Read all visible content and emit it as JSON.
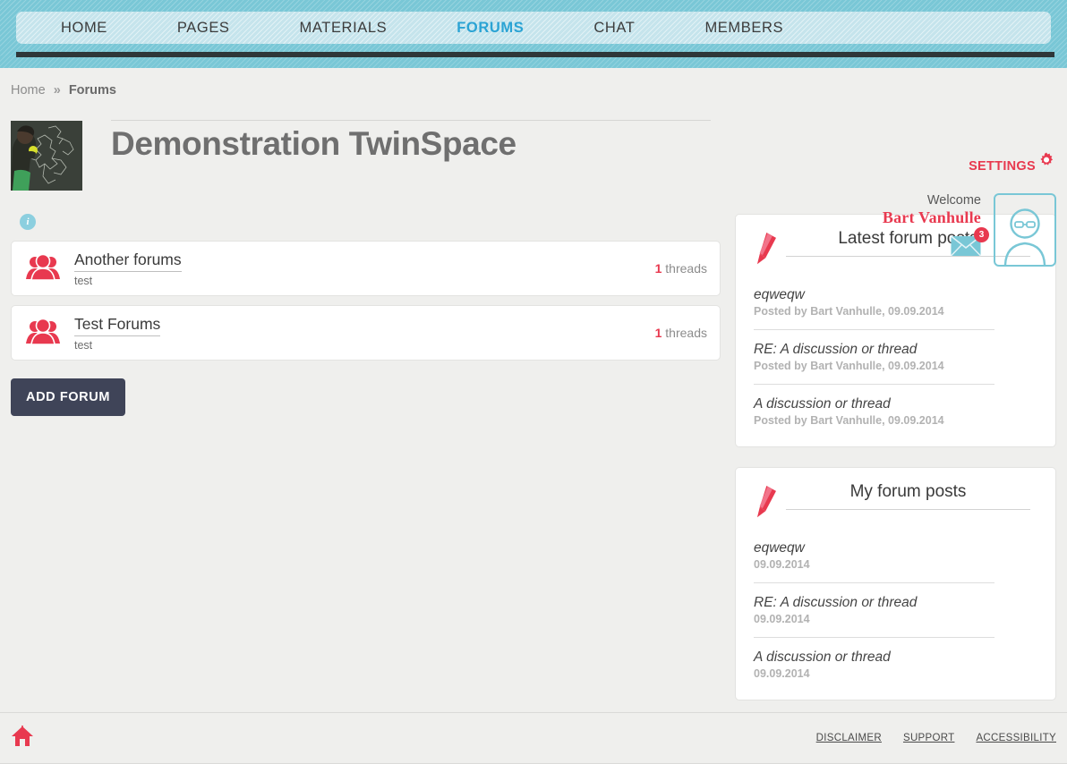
{
  "nav": {
    "items": [
      {
        "label": "HOME",
        "active": false
      },
      {
        "label": "PAGES",
        "active": false
      },
      {
        "label": "MATERIALS",
        "active": false
      },
      {
        "label": "FORUMS",
        "active": true
      },
      {
        "label": "CHAT",
        "active": false
      },
      {
        "label": "MEMBERS",
        "active": false
      }
    ]
  },
  "breadcrumb": {
    "home": "Home",
    "separator": "»",
    "current": "Forums"
  },
  "settings": {
    "label": "SETTINGS",
    "icon": "gear-icon"
  },
  "header": {
    "title": "Demonstration TwinSpace",
    "thumbnail_icon": "twinspace-thumbnail"
  },
  "user": {
    "welcome_label": "Welcome",
    "name": "Bart Vanhulle",
    "messages_count": "3",
    "mail_icon": "envelope-icon",
    "avatar_icon": "user-avatar-icon"
  },
  "forums": {
    "info_icon": "info-icon",
    "items": [
      {
        "title": "Another forums",
        "description": "test",
        "thread_count": "1",
        "thread_label": "threads"
      },
      {
        "title": "Test Forums",
        "description": "test",
        "thread_count": "1",
        "thread_label": "threads"
      }
    ],
    "add_button": "ADD FORUM"
  },
  "panels": [
    {
      "title": "Latest forum posts",
      "icon": "pencil-icon",
      "posts": [
        {
          "title": "eqweqw",
          "meta": "Posted by Bart Vanhulle, 09.09.2014"
        },
        {
          "title": "RE: A discussion or thread",
          "meta": "Posted by Bart Vanhulle, 09.09.2014"
        },
        {
          "title": "A discussion or thread",
          "meta": "Posted by Bart Vanhulle, 09.09.2014"
        }
      ]
    },
    {
      "title": "My forum posts",
      "icon": "pencil-icon",
      "posts": [
        {
          "title": "eqweqw",
          "meta": "09.09.2014"
        },
        {
          "title": "RE: A discussion or thread",
          "meta": "09.09.2014"
        },
        {
          "title": "A discussion or thread",
          "meta": "09.09.2014"
        }
      ]
    }
  ],
  "footer": {
    "home_icon": "home-icon",
    "links": [
      {
        "label": "DISCLAIMER"
      },
      {
        "label": "SUPPORT"
      },
      {
        "label": "ACCESSIBILITY"
      }
    ]
  },
  "colors": {
    "accent_red": "#e8394f",
    "teal": "#79c7d6",
    "nav_pill": "#c5e4ec",
    "dark_rule": "#2e3639",
    "button_navy": "#3f4458",
    "page_bg": "#efefed",
    "nav_active": "#2aa3d4"
  }
}
